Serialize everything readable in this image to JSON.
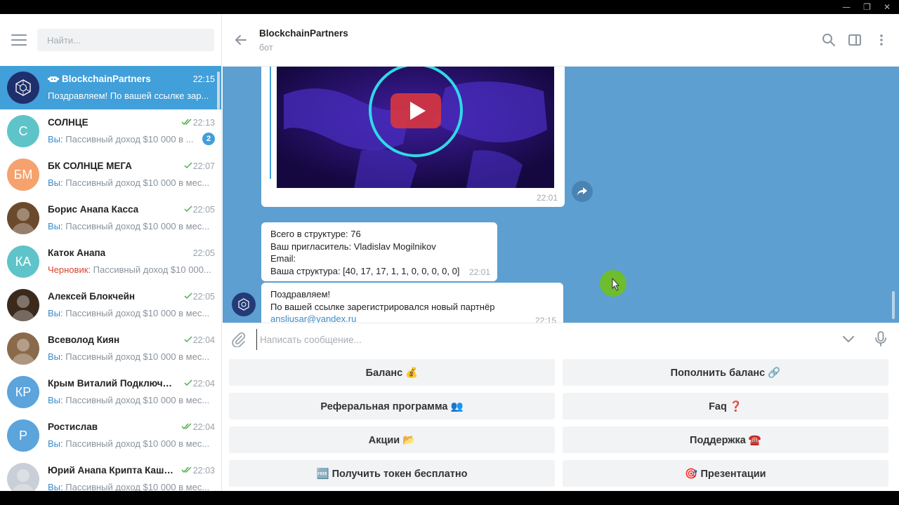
{
  "window_controls": {
    "minimize": "—",
    "restore": "❐",
    "close": "✕"
  },
  "search": {
    "placeholder": "Найти..."
  },
  "chats": [
    {
      "name": "BlockchainPartners",
      "time": "22:15",
      "prefix": "",
      "message": "Поздравляем! По вашей ссылке зар...",
      "avatar_text": "",
      "avatar_color": "#1f2f6b",
      "active": true,
      "is_bot": true,
      "read": "none",
      "badge": ""
    },
    {
      "name": "СОЛНЦЕ",
      "time": "22:13",
      "prefix": "Вы:",
      "message": " Пассивный доход $10 000 в ...",
      "avatar_text": "С",
      "avatar_color": "#5fc4c9",
      "active": false,
      "read": "double",
      "badge": "2"
    },
    {
      "name": "БК СОЛНЦЕ МЕГА",
      "time": "22:07",
      "prefix": "Вы:",
      "message": " Пассивный доход $10 000 в мес...",
      "avatar_text": "БМ",
      "avatar_color": "#f5a26e",
      "active": false,
      "read": "single",
      "badge": ""
    },
    {
      "name": "Борис Анапа Касса",
      "time": "22:05",
      "prefix": "Вы:",
      "message": " Пассивный доход $10 000 в мес...",
      "avatar_text": "",
      "avatar_color": "#6b4a2c",
      "active": false,
      "read": "single",
      "badge": ""
    },
    {
      "name": "Каток Анапа",
      "time": "22:05",
      "prefix": "Черновик:",
      "message": " Пассивный доход $10 000...",
      "avatar_text": "КА",
      "avatar_color": "#5fc4c9",
      "active": false,
      "read": "none",
      "badge": "",
      "draft": true
    },
    {
      "name": "Алексей Блокчейн",
      "time": "22:05",
      "prefix": "Вы:",
      "message": " Пассивный доход $10 000 в мес...",
      "avatar_text": "",
      "avatar_color": "#3b2a1c",
      "active": false,
      "read": "single",
      "badge": ""
    },
    {
      "name": "Всеволод Киян",
      "time": "22:04",
      "prefix": "Вы:",
      "message": " Пассивный доход $10 000 в мес...",
      "avatar_text": "",
      "avatar_color": "#8a6a4a",
      "active": false,
      "read": "single",
      "badge": ""
    },
    {
      "name": "Крым Виталий Подключе...",
      "time": "22:04",
      "prefix": "Вы:",
      "message": " Пассивный доход $10 000 в мес...",
      "avatar_text": "КР",
      "avatar_color": "#5ba4dc",
      "active": false,
      "read": "single",
      "badge": ""
    },
    {
      "name": "Ростислав",
      "time": "22:04",
      "prefix": "Вы:",
      "message": " Пассивный доход $10 000 в мес...",
      "avatar_text": "Р",
      "avatar_color": "#5ba4dc",
      "active": false,
      "read": "double",
      "badge": ""
    },
    {
      "name": "Юрий Анапа Крипта Каше...",
      "time": "22:03",
      "prefix": "Вы:",
      "message": " Пассивный доход $10 000 в мес...",
      "avatar_text": "",
      "avatar_color": "#c9cfd6",
      "active": false,
      "read": "double",
      "badge": ""
    }
  ],
  "header": {
    "title": "BlockchainPartners",
    "status": "бот"
  },
  "messages": [
    {
      "type": "video",
      "time": "22:01"
    },
    {
      "type": "text",
      "lines": [
        "Всего в структуре: 76",
        "Ваш пригласитель: Vladislav Mogilnikov",
        "Email:",
        "Ваша структура: [40, 17, 17, 1, 1, 0, 0, 0, 0, 0]"
      ],
      "time": "22:01"
    },
    {
      "type": "text",
      "lines": [
        "Поздравляем!",
        "По вашей ссылке зарегистрировался новый партнёр"
      ],
      "link": "ansliusar@yandex.ru",
      "time": "22:15"
    }
  ],
  "compose": {
    "placeholder": "Написать сообщение..."
  },
  "keyboard": [
    {
      "label": "Баланс 💰"
    },
    {
      "label": "Пополнить баланс 🔗"
    },
    {
      "label": "Реферальная программа 👥"
    },
    {
      "label": "Faq ❓"
    },
    {
      "label": "Акции 📂"
    },
    {
      "label": "Поддержка ☎️"
    },
    {
      "label": "🆓 Получить токен бесплатно"
    },
    {
      "label": "🎯 Презентации"
    }
  ],
  "colors": {
    "accent": "#419fd9",
    "chat_bg": "#5d9fd0",
    "check": "#4fae4e",
    "draft": "#d6452d"
  }
}
